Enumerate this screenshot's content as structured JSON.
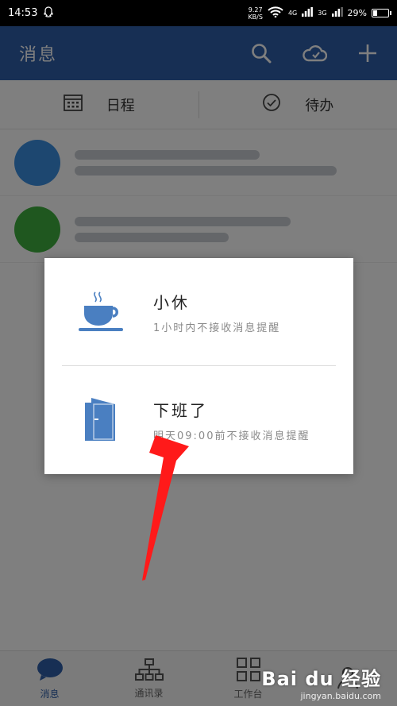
{
  "status_bar": {
    "time": "14:53",
    "net_speed_value": "9.27",
    "net_speed_unit": "KB/S",
    "signal_1": "4G",
    "signal_2": "3G",
    "battery": "29%",
    "battery_level": 0.29
  },
  "app_bar": {
    "title": "消息",
    "icons": [
      "search-icon",
      "cloud-icon",
      "plus-icon"
    ]
  },
  "tabs": [
    {
      "label": "日程",
      "icon": "calendar-icon"
    },
    {
      "label": "待办",
      "icon": "check-circle-icon"
    }
  ],
  "dialog": {
    "options": [
      {
        "title": "小休",
        "desc": "1小时内不接收消息提醒",
        "icon": "coffee-cup-icon"
      },
      {
        "title": "下班了",
        "desc": "明天09:00前不接收消息提醒",
        "icon": "door-icon"
      }
    ]
  },
  "bottom_nav": [
    {
      "label": "消息",
      "icon": "chat-bubble-icon"
    },
    {
      "label": "通讯录",
      "icon": "org-chart-icon"
    },
    {
      "label": "工作台",
      "icon": "grid-icon"
    }
  ],
  "watermark": {
    "logo": "Bai du 经验",
    "url": "jingyan.baidu.com"
  },
  "colors": {
    "primary": "#2f5fa8",
    "icon_blue": "#4a7fc1",
    "arrow_red": "#ff1a1a"
  }
}
